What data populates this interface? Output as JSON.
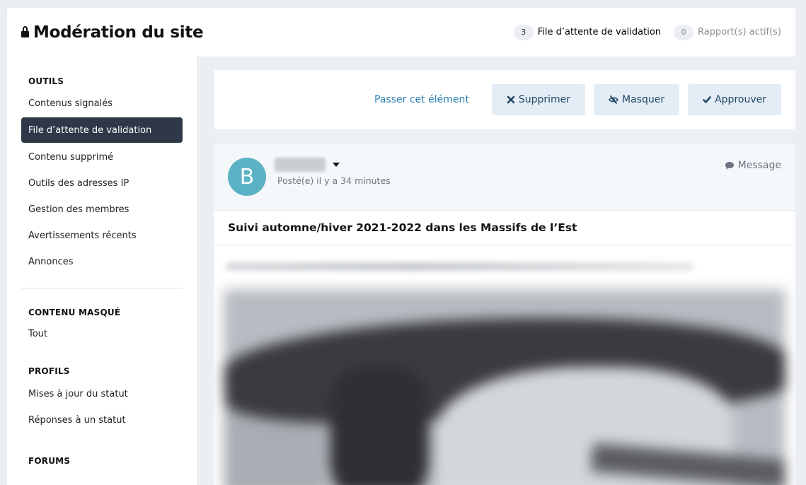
{
  "header": {
    "title": "Modération du site",
    "queue_count": "3",
    "queue_label": "File d’attente de validation",
    "reports_count": "0",
    "reports_label": "Rapport(s) actif(s)"
  },
  "sidebar": {
    "sections": [
      {
        "heading": "OUTILS",
        "items": [
          "Contenus signalés",
          "File d’attente de validation",
          "Contenu supprimé",
          "Outils des adresses IP",
          "Gestion des membres",
          "Avertissements récents",
          "Annonces"
        ]
      },
      {
        "heading": "CONTENU MASQUÉ",
        "items": [
          "Tout"
        ]
      },
      {
        "heading": "PROFILS",
        "items": [
          "Mises à jour du statut",
          "Réponses à un statut"
        ]
      },
      {
        "heading": "FORUMS",
        "items": []
      }
    ],
    "active_item": "File d’attente de validation"
  },
  "actions": {
    "skip": "Passer cet élément",
    "delete": "Supprimer",
    "hide": "Masquer",
    "approve": "Approuver"
  },
  "post": {
    "avatar_letter": "B",
    "posted": "Posté(e) il y a 34 minutes",
    "message_link": "Message",
    "title": "Suivi automne/hiver 2021-2022 dans les Massifs de l’Est"
  },
  "colors": {
    "accent": "#2c7fb3",
    "sidebar_active": "#2f3848",
    "avatar": "#5ab3c4",
    "button_bg": "#e4edf6"
  }
}
